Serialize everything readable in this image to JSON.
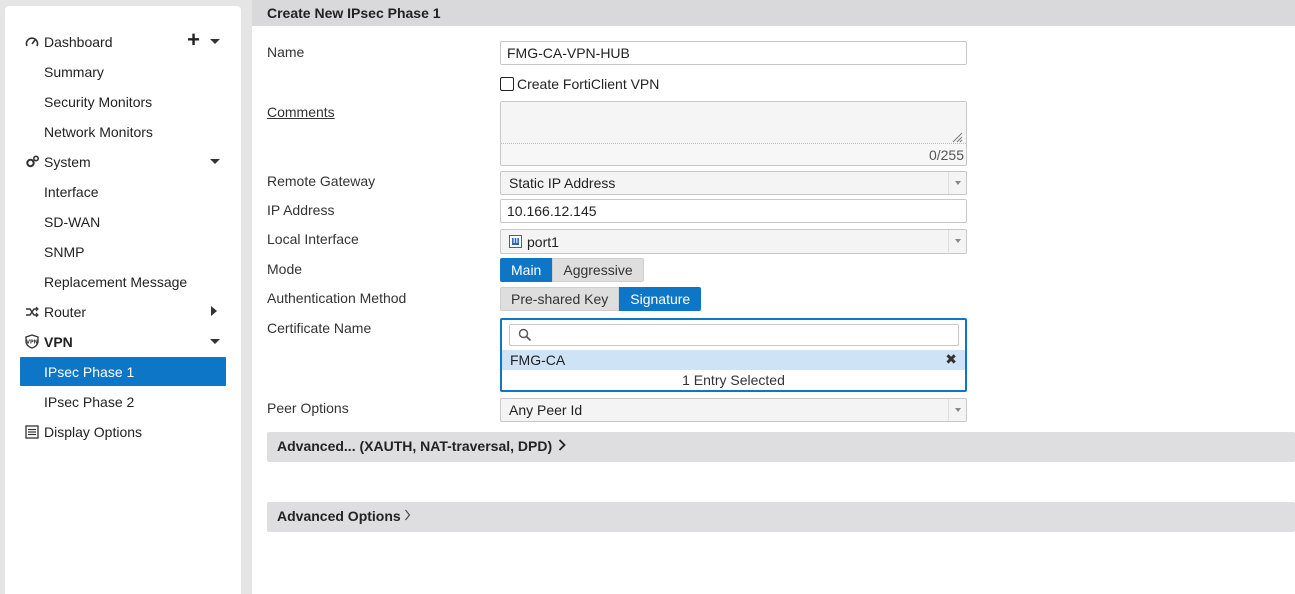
{
  "sidebar": {
    "dashboard": "Dashboard",
    "summary": "Summary",
    "security_monitors": "Security Monitors",
    "network_monitors": "Network Monitors",
    "system": "System",
    "interface": "Interface",
    "sdwan": "SD-WAN",
    "snmp": "SNMP",
    "replacement_message": "Replacement Message",
    "router": "Router",
    "vpn": "VPN",
    "ipsec_phase1": "IPsec Phase 1",
    "ipsec_phase2": "IPsec Phase 2",
    "display_options": "Display Options",
    "plus_symbol": "+"
  },
  "page": {
    "title": "Create New IPsec Phase 1"
  },
  "form": {
    "name_label": "Name",
    "name_value": "FMG-CA-VPN-HUB",
    "forticlient_label": "Create FortiClient VPN",
    "forticlient_checked": false,
    "comments_label": "Comments",
    "comments_value": "",
    "comments_count": "0/255",
    "remote_gateway_label": "Remote Gateway",
    "remote_gateway_value": "Static IP Address",
    "ip_address_label": "IP Address",
    "ip_address_value": "10.166.12.145",
    "local_interface_label": "Local Interface",
    "local_interface_value": "port1",
    "mode_label": "Mode",
    "mode_main": "Main",
    "mode_aggressive": "Aggressive",
    "auth_method_label": "Authentication Method",
    "auth_psk": "Pre-shared Key",
    "auth_signature": "Signature",
    "cert_name_label": "Certificate Name",
    "cert_search_value": "",
    "cert_selected": "FMG-CA",
    "cert_remove": "✖",
    "cert_count": "1 Entry Selected",
    "peer_options_label": "Peer Options",
    "peer_options_value": "Any Peer Id"
  },
  "sections": {
    "advanced_xauth": "Advanced... (XAUTH, NAT-traversal, DPD)",
    "advanced_options": "Advanced Options"
  },
  "colors": {
    "accent": "#0e76c6",
    "header_bg": "#d9d9db",
    "selected_entry": "#cfe3f6"
  }
}
